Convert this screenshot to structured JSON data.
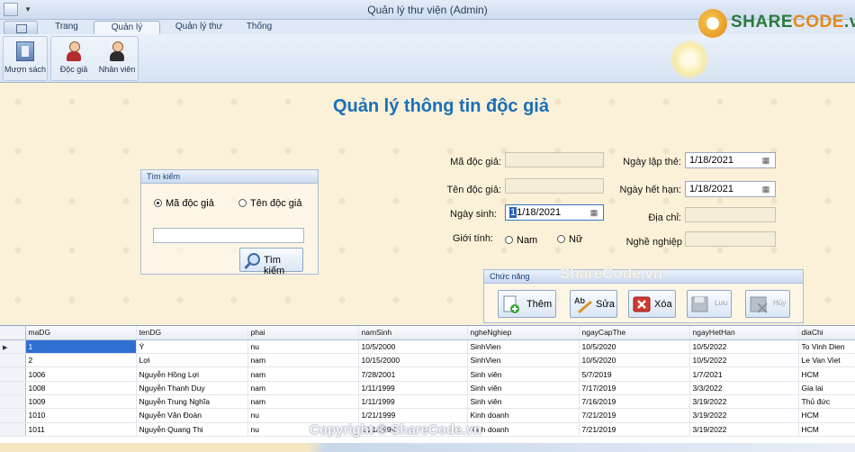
{
  "window": {
    "title": "Quản lý thư viện (Admin)"
  },
  "logo": {
    "text_a": "SHARE",
    "text_b": "CODE",
    "text_c": ".vn"
  },
  "tabs": [
    {
      "label": "Trang chủ"
    },
    {
      "label": "Quản lý thông tin"
    },
    {
      "label": "Quản lý thư viện"
    },
    {
      "label": "Thống kê"
    }
  ],
  "ribbon": {
    "buttons": [
      {
        "label": "Mượn sách",
        "icon": "book-icon"
      },
      {
        "label": "Độc giả",
        "icon": "reader-icon"
      },
      {
        "label": "Nhân viên",
        "icon": "staff-icon"
      }
    ]
  },
  "page": {
    "title": "Quản lý thông tin độc giả"
  },
  "search": {
    "header": "Tìm kiếm",
    "option_id": "Mã độc giả",
    "option_name": "Tên độc giả",
    "selected": "Mã độc giả",
    "query": "",
    "button": "Tìm kiếm"
  },
  "form": {
    "ma_label": "Mã độc giả:",
    "ten_label": "Tên độc giả:",
    "ngaysinh_label": "Ngày sinh:",
    "ngaysinh_value": "1/18/2021",
    "gioitinh_label": "Giới tính:",
    "nam_label": "Nam",
    "nu_label": "Nữ",
    "ngaylap_label": "Ngày lập thẻ:",
    "ngaylap_value": "1/18/2021",
    "ngayhet_label": "Ngày hết hạn:",
    "ngayhet_value": "1/18/2021",
    "diachi_label": "Địa chỉ:",
    "nghenghiep_label": "Nghề nghiệp"
  },
  "actions": {
    "header": "Chức năng",
    "them": "Thêm",
    "sua": "Sửa",
    "xoa": "Xóa",
    "luu": "Lưu",
    "huy": "Hủy"
  },
  "watermarks": {
    "middle": "ShareCode.vn",
    "copyright": "Copyright © ShareCode.vn"
  },
  "grid": {
    "columns": [
      "maDG",
      "tenDG",
      "phai",
      "namSinh",
      "ngheNghiep",
      "ngayCapThe",
      "ngayHetHan",
      "diaChi"
    ],
    "rows": [
      [
        "1",
        "Ý",
        "nu",
        "10/5/2000",
        "SinhVien",
        "10/5/2020",
        "10/5/2022",
        "To Vinh Dien"
      ],
      [
        "2",
        "Lợi",
        "nam",
        "10/15/2000",
        "SinhVien",
        "10/5/2020",
        "10/5/2022",
        "Le Van Viet"
      ],
      [
        "1006",
        "Nguyễn Hồng Lợi",
        "nam",
        "7/28/2001",
        "Sinh viên",
        "5/7/2019",
        "1/7/2021",
        "HCM"
      ],
      [
        "1008",
        "Nguyễn Thanh Duy",
        "nam",
        "1/11/1999",
        "Sinh viên",
        "7/17/2019",
        "3/3/2022",
        "Gia lai"
      ],
      [
        "1009",
        "Nguyễn Trung Nghĩa",
        "nam",
        "1/11/1999",
        "Sinh viên",
        "7/16/2019",
        "3/19/2022",
        "Thủ đức"
      ],
      [
        "1010",
        "Nguyễn Văn Đoàn",
        "nu",
        "1/21/1999",
        "Kinh doanh",
        "7/21/2019",
        "3/19/2022",
        "HCM"
      ],
      [
        "1011",
        "Nguyễn Quang Thi",
        "nu",
        "1/21/1999",
        "Kinh doanh",
        "7/21/2019",
        "3/19/2022",
        "HCM"
      ]
    ],
    "current_marker": "▶"
  }
}
